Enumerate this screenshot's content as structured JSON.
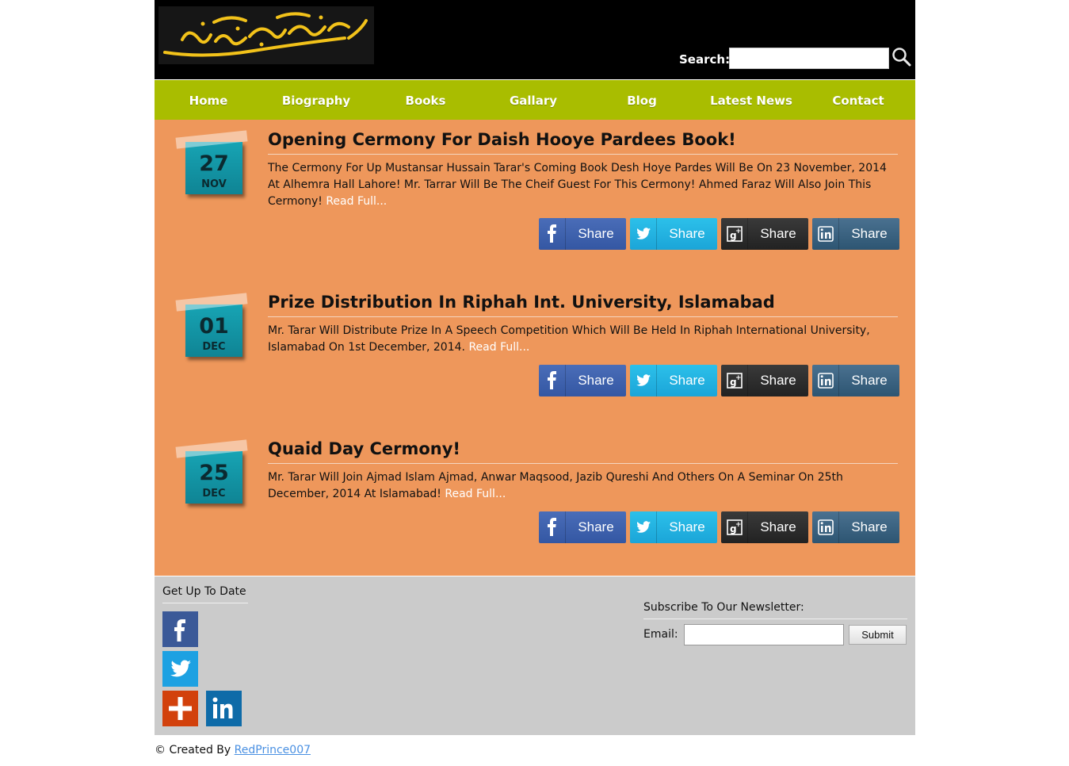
{
  "header": {
    "logo_text": "مستنصر حسین تارڑ",
    "search_label": "Search:",
    "search_value": ""
  },
  "nav": {
    "items": [
      {
        "label": "Home"
      },
      {
        "label": "Biography"
      },
      {
        "label": "Books"
      },
      {
        "label": "Gallary"
      },
      {
        "label": "Blog"
      },
      {
        "label": "Latest News"
      },
      {
        "label": "Contact"
      }
    ]
  },
  "posts": [
    {
      "day": "27",
      "month": "NOV",
      "title": "Opening Cermony For Daish Hooye Pardees Book!",
      "body": "The Cermony For Up Mustansar Hussain Tarar's Coming Book Desh Hoye Pardes Will Be On 23 November, 2014 At Alhemra Hall Lahore! Mr. Tarrar Will Be The Cheif Guest For This Cermony! Ahmed Faraz Will Also Join This Cermony!",
      "read_more": "Read Full..."
    },
    {
      "day": "01",
      "month": "DEC",
      "title": "Prize Distribution In Riphah Int. University, Islamabad",
      "body": "Mr. Tarar Will Distribute Prize In A Speech Competition Which Will Be Held In Riphah International University, Islamabad On 1st December, 2014.",
      "read_more": "Read Full..."
    },
    {
      "day": "25",
      "month": "DEC",
      "title": "Quaid Day Cermony!",
      "body": "Mr. Tarar Will Join Ajmad Islam Ajmad, Anwar Maqsood, Jazib Qureshi And Others On A Seminar On 25th December, 2014 At Islamabad!",
      "read_more": "Read Full..."
    }
  ],
  "share": {
    "label": "Share",
    "networks": [
      "facebook",
      "twitter",
      "google-plus",
      "linkedin"
    ],
    "colors": {
      "facebook": "#3b5ca8",
      "twitter": "#22b2e2",
      "google-plus": "#2a2a2a",
      "linkedin": "#365f80"
    }
  },
  "footer": {
    "heading": "Get Up To Date",
    "social_icons": [
      "facebook-icon",
      "twitter-icon",
      "google-plus-icon",
      "linkedin-icon"
    ],
    "newsletter_title": "Subscribe To Our Newsletter:",
    "email_label": "Email:",
    "email_value": "",
    "submit_label": "Submit"
  },
  "credit": {
    "prefix": "© Created By",
    "author": "RedPrince007"
  },
  "colors": {
    "header_bg": "#000000",
    "nav_bg": "#a9bd00",
    "main_bg": "#ee975b",
    "footer_bg": "#cbcbcb",
    "date_badge": "#139aab",
    "link": "#4a90e2"
  }
}
